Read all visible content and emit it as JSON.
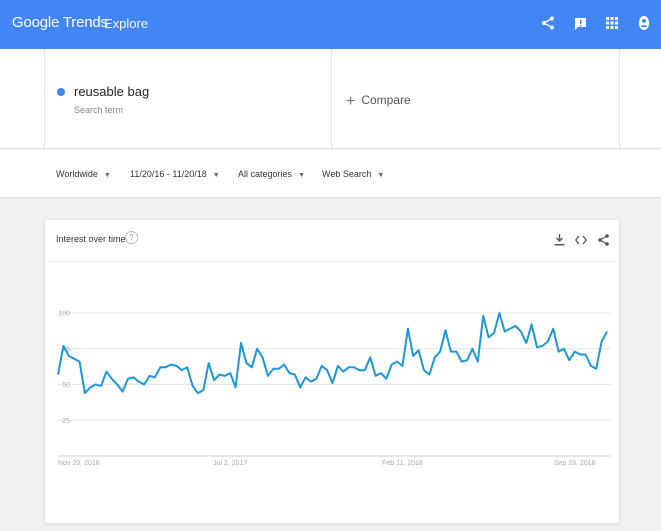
{
  "header": {
    "brand": "Google Trends",
    "nav_label": "Explore",
    "icons": [
      "share-icon",
      "feedback-icon",
      "apps-icon",
      "account-icon"
    ],
    "accent_color": "#4285f4"
  },
  "search": {
    "term": "reusable bag",
    "term_type": "Search term",
    "term_color": "#4285f4",
    "compare_label": "Compare"
  },
  "filters": {
    "region": "Worldwide",
    "date_range": "11/20/16 - 11/20/18",
    "category": "All categories",
    "property": "Web Search"
  },
  "card": {
    "title": "Interest over time",
    "help": "?",
    "actions": [
      "download-icon",
      "embed-icon",
      "share-icon"
    ]
  },
  "chart_data": {
    "type": "line",
    "title": "Interest over time",
    "series_color": "#1c97d7",
    "ylim": [
      0,
      100
    ],
    "y_ticks": [
      "100",
      "75",
      "50",
      "25"
    ],
    "y_tick_values": [
      100,
      75,
      50,
      25
    ],
    "x_tick_labels": [
      "Nov 20, 2016",
      "Jul 2, 2017",
      "Feb 11, 2018",
      "Sep 23, 2018"
    ],
    "x_tick_index": [
      0,
      32,
      64,
      96
    ],
    "grid": true,
    "series": [
      {
        "values": [
          57,
          77,
          70,
          68,
          66,
          44,
          48,
          50,
          49,
          59,
          54,
          50,
          45,
          54,
          55,
          52,
          50,
          56,
          55,
          62,
          62,
          64,
          63,
          60,
          62,
          49,
          44,
          46,
          65,
          53,
          57,
          56,
          58,
          48,
          79,
          65,
          62,
          75,
          69,
          56,
          61,
          61,
          64,
          58,
          57,
          48,
          55,
          52,
          54,
          63,
          60,
          51,
          63,
          59,
          62,
          62,
          60,
          60,
          69,
          56,
          58,
          54,
          64,
          66,
          63,
          89,
          70,
          74,
          60,
          57,
          69,
          73,
          88,
          73,
          73,
          66,
          67,
          75,
          66,
          98,
          83,
          86,
          100,
          87,
          89,
          91,
          87,
          79,
          92,
          76,
          77,
          80,
          89,
          73,
          75,
          67,
          73,
          71,
          71,
          63,
          61,
          80,
          87
        ]
      }
    ]
  }
}
